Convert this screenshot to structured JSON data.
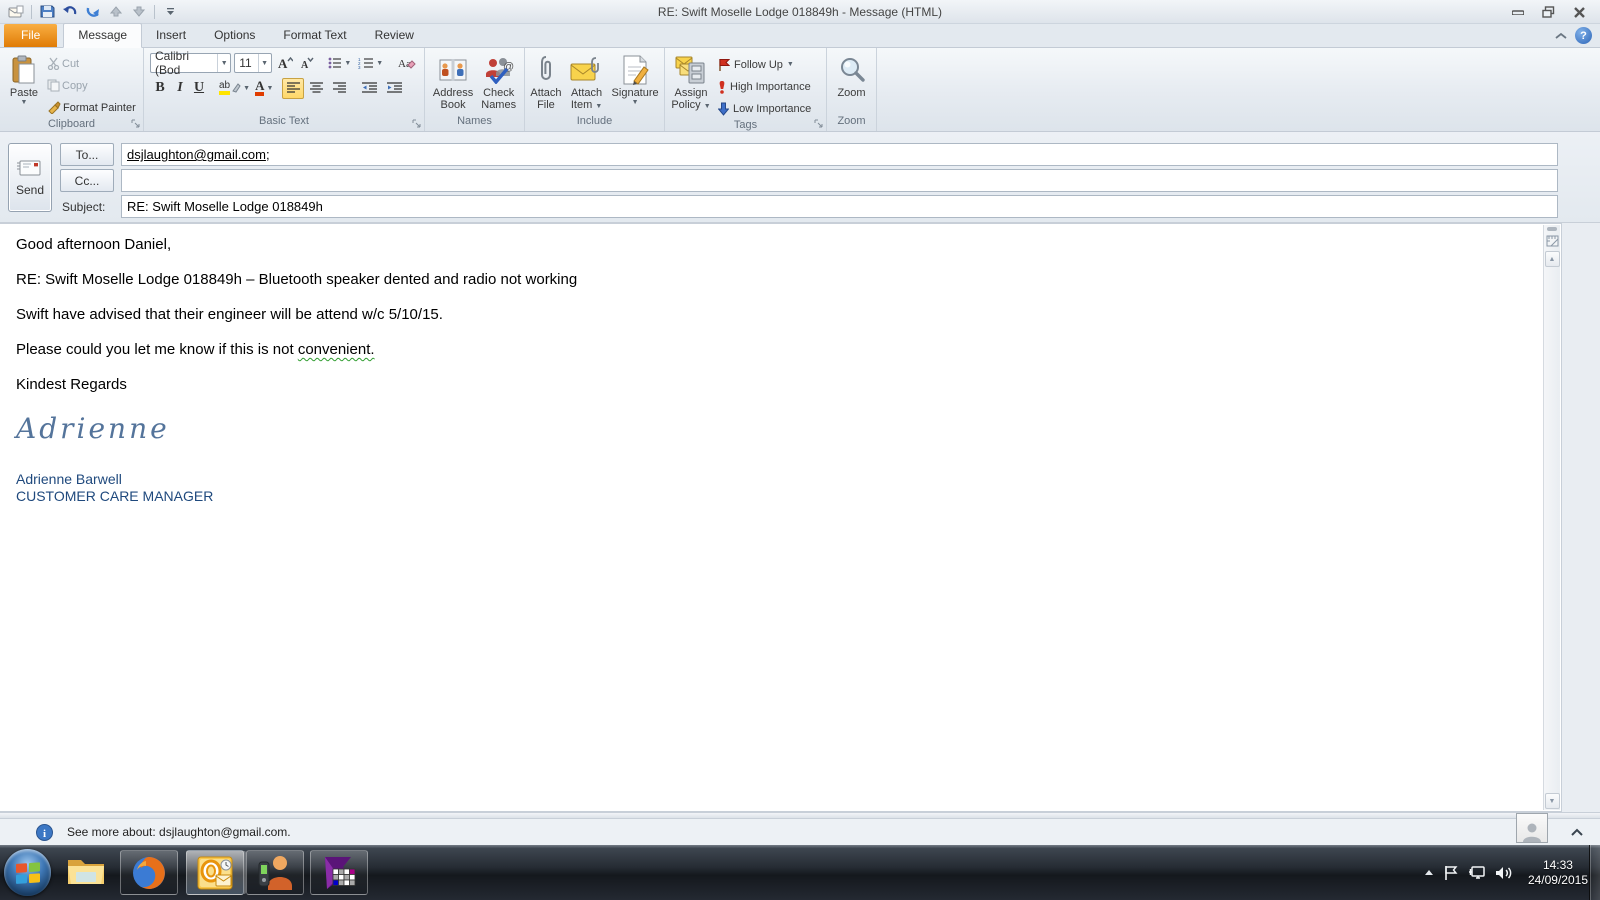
{
  "window": {
    "title": "RE: Swift Moselle Lodge 018849h   -   Message (HTML)",
    "help_glyph": "?"
  },
  "tabs": {
    "file": "File",
    "message": "Message",
    "insert": "Insert",
    "options": "Options",
    "format_text": "Format Text",
    "review": "Review"
  },
  "ribbon": {
    "clipboard": {
      "group": "Clipboard",
      "paste": "Paste",
      "cut": "Cut",
      "copy": "Copy",
      "format_painter": "Format Painter"
    },
    "basic_text": {
      "group": "Basic Text",
      "font_name": "Calibri (Bod",
      "font_size": "11",
      "bold": "B",
      "italic": "I",
      "underline": "U",
      "highlight_glyph": "ab",
      "font_color_glyph": "A",
      "clear_glyph": "Aa"
    },
    "names": {
      "group": "Names",
      "address_book_1": "Address",
      "address_book_2": "Book",
      "check_names_1": "Check",
      "check_names_2": "Names"
    },
    "include": {
      "group": "Include",
      "attach_file_1": "Attach",
      "attach_file_2": "File",
      "attach_item_1": "Attach",
      "attach_item_2": "Item",
      "signature": "Signature"
    },
    "tags": {
      "group": "Tags",
      "assign_policy_1": "Assign",
      "assign_policy_2": "Policy",
      "follow_up": "Follow Up",
      "high_importance": "High Importance",
      "low_importance": "Low Importance"
    },
    "zoom": {
      "group": "Zoom",
      "zoom": "Zoom"
    }
  },
  "header": {
    "send": "Send",
    "to_button": "To...",
    "cc_button": "Cc...",
    "subject_label": "Subject:",
    "to_email": "dsjlaughton@gmail.com",
    "to_suffix": ";",
    "cc_value": "",
    "subject_value": "RE: Swift Moselle Lodge 018849h"
  },
  "body": {
    "p1": "Good afternoon Daniel,",
    "p2": "RE: Swift Moselle Lodge 018849h – Bluetooth speaker dented and radio not working",
    "p3": "Swift have advised that their engineer will be attend w/c 5/10/15.",
    "p4_pre": "Please could you let me know if this is not ",
    "p4_flagged": "convenient.",
    "p5": "Kindest Regards",
    "signature_script": "Adrienne",
    "signature_name": "Adrienne Barwell",
    "signature_title": "CUSTOMER CARE MANAGER"
  },
  "people_pane": {
    "status_text": "See more about: dsjlaughton@gmail.com."
  },
  "taskbar": {
    "time": "14:33",
    "date": "24/09/2015"
  },
  "icons": {
    "qat": [
      "message-icon",
      "save-icon",
      "undo-icon",
      "redo-icon",
      "previous-item-icon",
      "next-item-icon",
      "customize-qat-icon"
    ],
    "colors": {
      "file_tab": "#E8820D",
      "signature_blue": "#1F497D",
      "script_blue": "#54749B",
      "grammar_green": "#2E9B2E",
      "align_active": "#FFE397"
    }
  }
}
